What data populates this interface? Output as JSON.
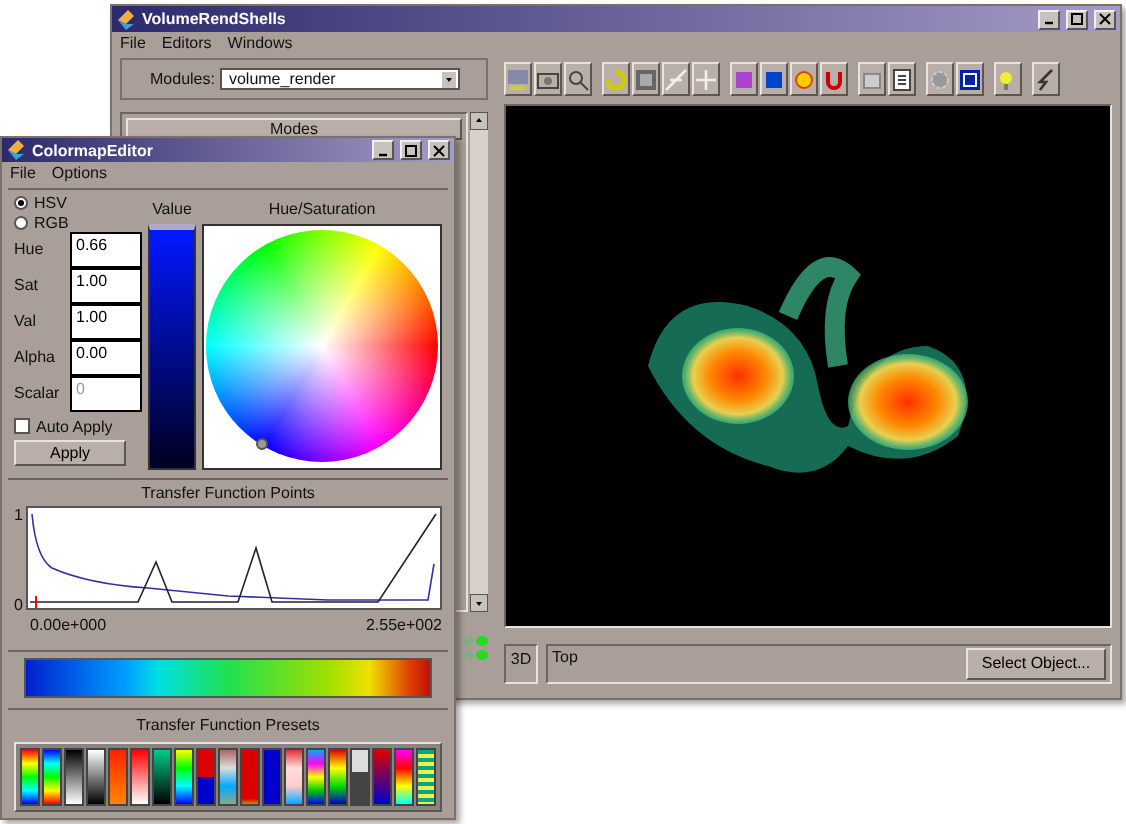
{
  "main_window": {
    "title": "VolumeRendShells",
    "menu": [
      "File",
      "Editors",
      "Windows"
    ],
    "modules_label": "Modules:",
    "modules_value": "volume_render",
    "modes_header": "Modes",
    "view_mode": "3D",
    "view_name": "Top",
    "select_button": "Select Object..."
  },
  "colormap_editor": {
    "title": "ColormapEditor",
    "menu": [
      "File",
      "Options"
    ],
    "color_modes": [
      {
        "label": "HSV",
        "selected": true
      },
      {
        "label": "RGB",
        "selected": false
      }
    ],
    "value_label": "Value",
    "hue_saturation_label": "Hue/Saturation",
    "fields": [
      {
        "label": "Hue",
        "value": "0.66",
        "disabled": false
      },
      {
        "label": "Sat",
        "value": "1.00",
        "disabled": false
      },
      {
        "label": "Val",
        "value": "1.00",
        "disabled": false
      },
      {
        "label": "Alpha",
        "value": "0.00",
        "disabled": false
      },
      {
        "label": "Scalar",
        "value": "0",
        "disabled": true
      }
    ],
    "auto_apply": {
      "label": "Auto Apply",
      "checked": false
    },
    "apply_button": "Apply",
    "transfer_points_title": "Transfer Function Points",
    "y_max_label": "1",
    "y_min_label": "0",
    "x_min_label": "0.00e+000",
    "x_max_label": "2.55e+002",
    "presets_title": "Transfer Function Presets"
  }
}
